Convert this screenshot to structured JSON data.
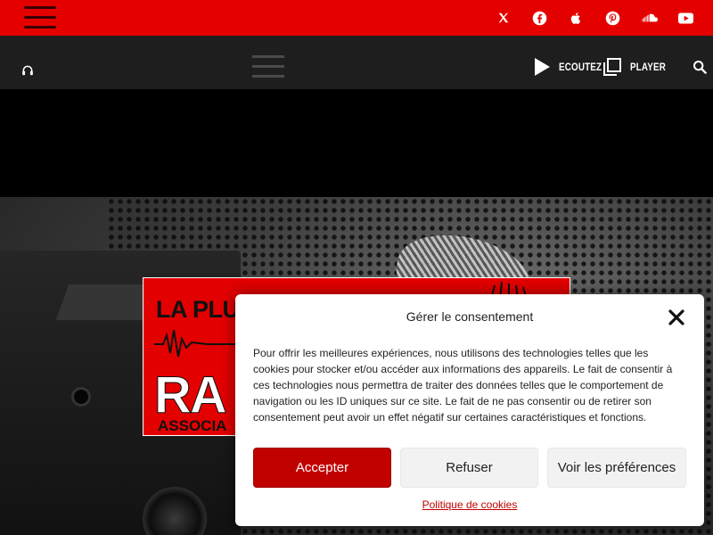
{
  "topbar": {
    "menu_icon": "hamburger-menu-icon",
    "socials": [
      {
        "name": "x-twitter",
        "icon": "x-icon"
      },
      {
        "name": "facebook",
        "icon": "facebook-icon"
      },
      {
        "name": "apple",
        "icon": "apple-icon"
      },
      {
        "name": "pinterest",
        "icon": "pinterest-icon"
      },
      {
        "name": "soundcloud",
        "icon": "soundcloud-icon"
      },
      {
        "name": "youtube",
        "icon": "youtube-icon"
      }
    ]
  },
  "navbar": {
    "listen_label": "ECOUTEZ",
    "player_label": "PLAYER",
    "search_icon": "search-icon"
  },
  "banner": {
    "line1": "LA PLUS",
    "line2": "RA",
    "line3": "ASSOCIA"
  },
  "consent": {
    "title": "Gérer le consentement",
    "body": "Pour offrir les meilleures expériences, nous utilisons des technologies telles que les cookies pour stocker et/ou accéder aux informations des appareils. Le fait de consentir à ces technologies nous permettra de traiter des données telles que le comportement de navigation ou les ID uniques sur ce site. Le fait de ne pas consentir ou de retirer son consentement peut avoir un effet négatif sur certaines caractéristiques et fonctions.",
    "accept_label": "Accepter",
    "refuse_label": "Refuser",
    "prefs_label": "Voir les préférences",
    "policy_link": "Politique de cookies"
  },
  "colors": {
    "brand_red": "#e50000",
    "accept_red": "#c10000",
    "nav_dark": "#1e1e1e"
  }
}
